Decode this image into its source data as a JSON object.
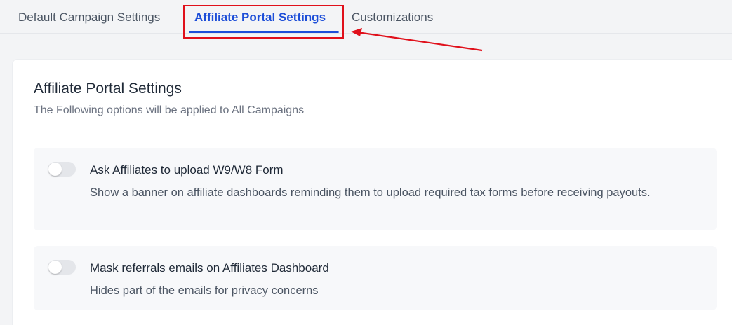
{
  "tabs": [
    {
      "label": "Default Campaign Settings",
      "active": false
    },
    {
      "label": "Affiliate Portal Settings",
      "active": true
    },
    {
      "label": "Customizations",
      "active": false
    }
  ],
  "colors": {
    "accent": "#1d4ed8",
    "annotation": "#e0101b",
    "background": "#f3f4f6",
    "panel": "#ffffff"
  },
  "panel": {
    "title": "Affiliate Portal Settings",
    "subtitle": "The Following options will be applied to All Campaigns"
  },
  "settings": [
    {
      "title": "Ask Affiliates to upload W9/W8 Form",
      "description": "Show a banner on affiliate dashboards reminding them to upload required tax forms before receiving payouts.",
      "enabled": false
    },
    {
      "title": "Mask referrals emails on Affiliates Dashboard",
      "description": "Hides part of the emails for privacy concerns",
      "enabled": false
    }
  ]
}
